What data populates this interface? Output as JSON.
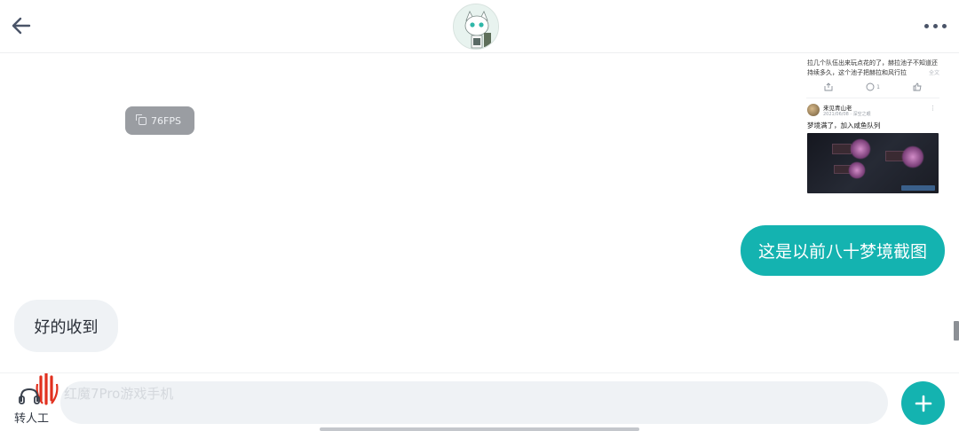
{
  "header": {
    "back_icon": "arrow-left-icon",
    "avatar_icon": "bot-avatar",
    "more_icon": "more-horizontal-icon"
  },
  "overlay": {
    "fps_label": "76FPS",
    "fps_icon": "copy-icon"
  },
  "messages": {
    "image_message": {
      "post_text": "拉几个队伍出来玩点花的了，赫拉池子不知道还持续多久，这个池子把赫拉和风行拉",
      "post_more": "全文",
      "comment_count": "1",
      "user_name": "来见青山老",
      "user_meta": "2021/06/08 · 深空之眼",
      "body": "梦境满了，加入咸鱼队列"
    },
    "outgoing_text": "这是以前八十梦境截图",
    "incoming_text": "好的收到"
  },
  "bottom": {
    "transfer_label": "转人工",
    "input_text": "红魔7Pro游戏手机",
    "add_icon": "plus-icon"
  },
  "colors": {
    "accent": "#14b3b0",
    "bubble_in": "#eff2f5",
    "icon_dark": "#4a5468"
  }
}
